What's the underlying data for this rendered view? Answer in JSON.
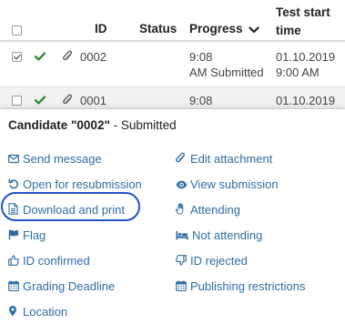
{
  "table": {
    "headers": {
      "id": "ID",
      "status": "Status",
      "progress": "Progress",
      "test_start_line1": "Test start",
      "test_start_line2": "time"
    },
    "rows": [
      {
        "selected": true,
        "status_icon": "check-icon",
        "attachment_icon": "paperclip-icon",
        "id": "0002",
        "progress_line1": "9:08",
        "progress_line2": "AM Submitted",
        "start_line1": "01.10.2019",
        "start_line2": "9:00 AM"
      },
      {
        "selected": false,
        "status_icon": "check-icon",
        "attachment_icon": "paperclip-icon",
        "id": "0001",
        "progress_line1": "9:08",
        "start_line1": "01.10.2019"
      }
    ]
  },
  "panel": {
    "title_prefix": "Candidate ",
    "title_candidate": "\"0002\"",
    "title_suffix": " - Submitted",
    "actions_left": [
      {
        "label": "Send message",
        "icon": "envelope-icon"
      },
      {
        "label": "Open for resubmission",
        "icon": "undo-icon"
      },
      {
        "label": "Download and print",
        "icon": "document-icon"
      },
      {
        "label": "Flag",
        "icon": "flag-icon"
      },
      {
        "label": "ID confirmed",
        "icon": "thumbs-up-icon"
      },
      {
        "label": "Grading Deadline",
        "icon": "calendar-icon"
      },
      {
        "label": "Location",
        "icon": "map-marker-icon"
      }
    ],
    "actions_right": [
      {
        "label": "Edit attachment",
        "icon": "paperclip-icon"
      },
      {
        "label": "View submission",
        "icon": "eye-icon"
      },
      {
        "label": "Attending",
        "icon": "hand-icon"
      },
      {
        "label": "Not attending",
        "icon": "bed-icon"
      },
      {
        "label": "ID rejected",
        "icon": "thumbs-down-icon"
      },
      {
        "label": "Publishing restrictions",
        "icon": "calendar-icon"
      }
    ]
  },
  "colors": {
    "link": "#2f6da3",
    "check": "#2e8b3a",
    "highlight": "#1f53c9"
  }
}
